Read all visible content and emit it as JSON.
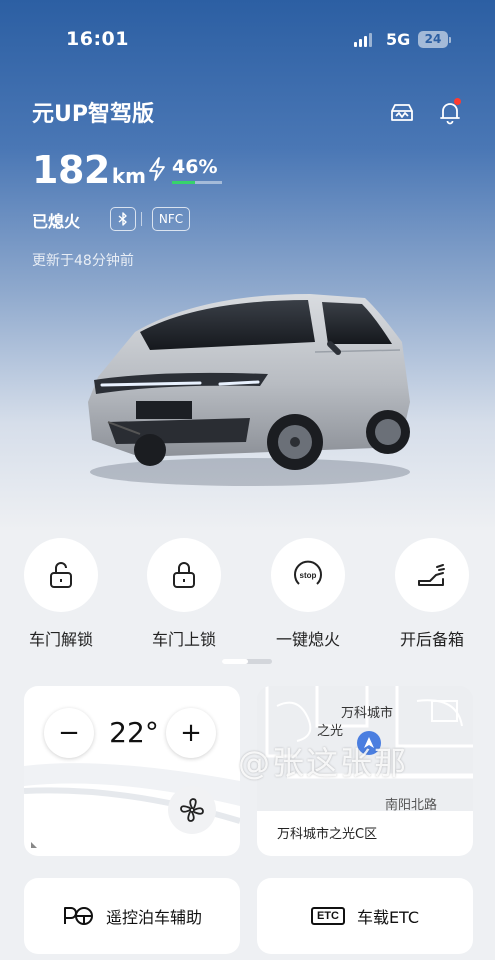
{
  "status_bar": {
    "time": "16:01",
    "network": "5G",
    "battery": "24"
  },
  "vehicle": {
    "name": "元UP智驾版",
    "range_value": "182",
    "range_unit": "km",
    "charge_percent": "46%",
    "charge_level": 0.46,
    "state": "已熄火",
    "nfc_label": "NFC",
    "updated": "更新于48分钟前"
  },
  "actions": [
    {
      "label": "车门解锁",
      "icon": "unlock-icon"
    },
    {
      "label": "车门上锁",
      "icon": "lock-icon"
    },
    {
      "label": "一键熄火",
      "icon": "stop-icon",
      "icon_text": "stop"
    },
    {
      "label": "开后备箱",
      "icon": "trunk-icon"
    }
  ],
  "climate": {
    "temperature": "22",
    "unit": "°",
    "minus": "−",
    "plus": "+"
  },
  "map": {
    "place_top": "万科城市",
    "place_mid": "之光",
    "road": "南阳北路",
    "address": "万科城市之光C区",
    "watermark": "@张这张那"
  },
  "tiles": [
    {
      "label": "遥控泊车辅助",
      "icon": "remote-parking-icon"
    },
    {
      "label": "车载ETC",
      "icon": "etc-icon",
      "icon_text": "ETC"
    }
  ],
  "colors": {
    "accent_blue": "#2c5fa3",
    "charge_green": "#37d36b",
    "alert_red": "#ff3b30"
  }
}
